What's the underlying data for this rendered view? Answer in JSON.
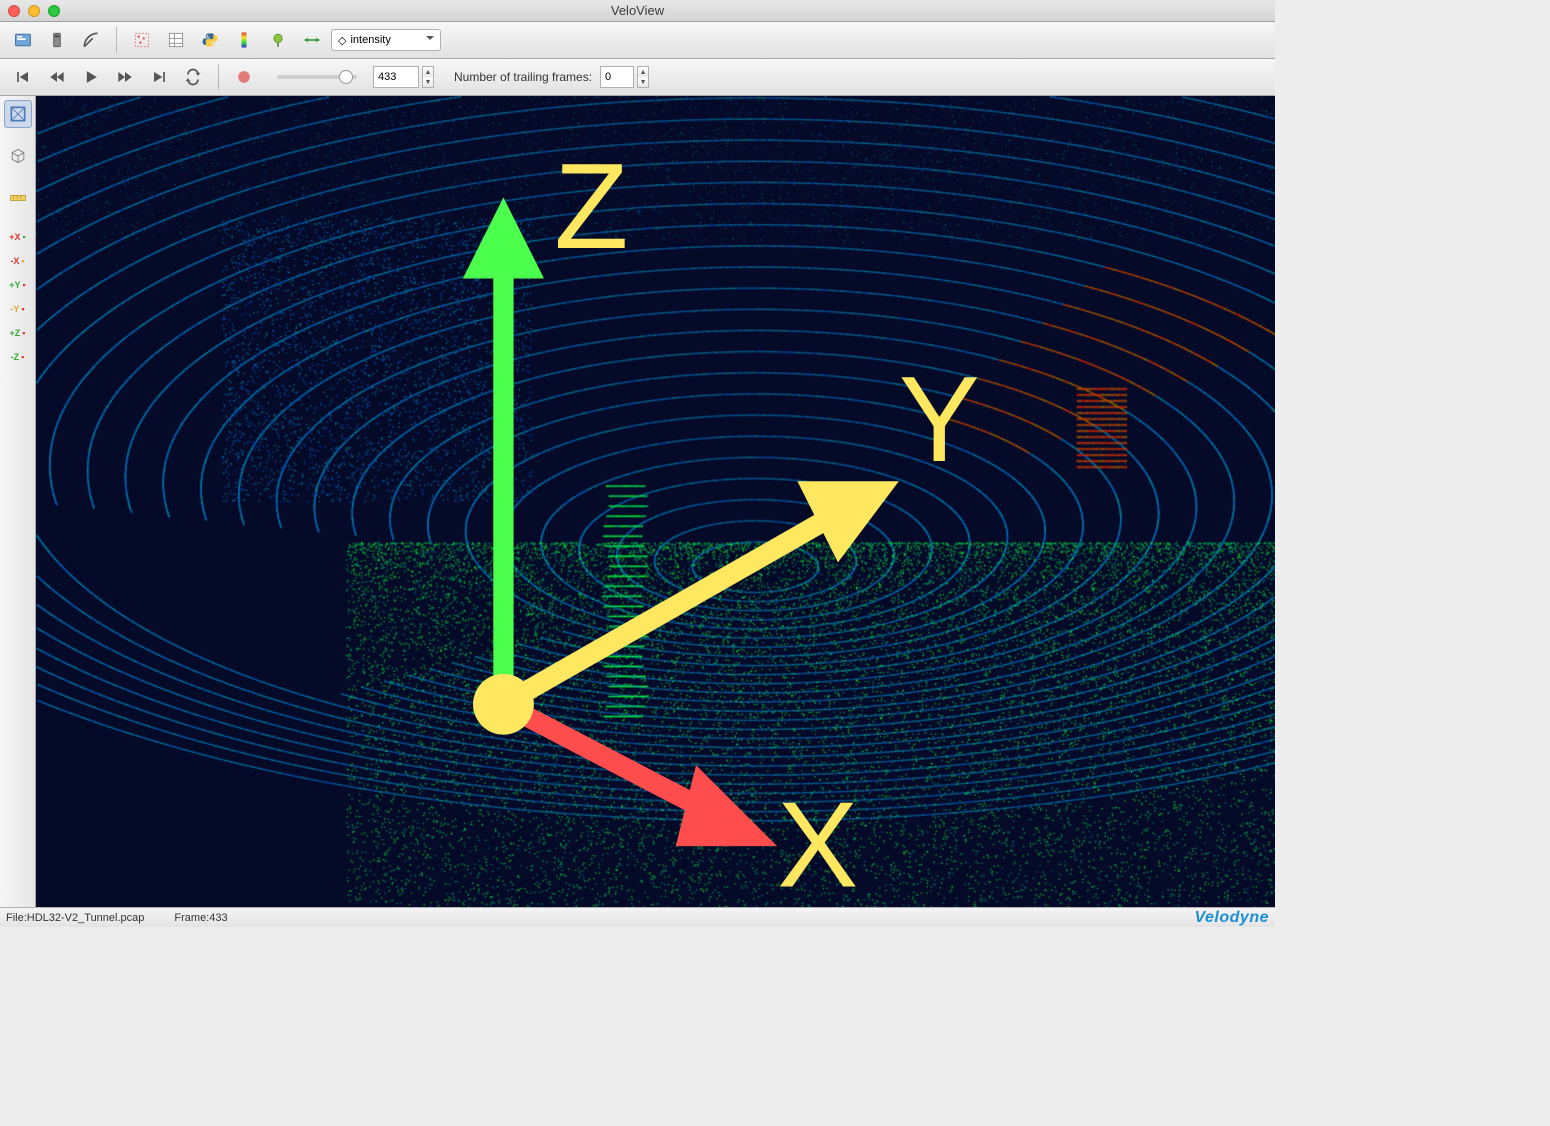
{
  "window": {
    "title": "VeloView"
  },
  "toolbar1": {
    "combo_label": "intensity",
    "icons": [
      "open-icon",
      "sensor-icon",
      "ruler-icon",
      "selection-icon",
      "spreadsheet-icon",
      "python-icon",
      "color-scale-icon",
      "crop-icon",
      "settings-icon"
    ]
  },
  "playback": {
    "frame": "433",
    "trailing_label": "Number of trailing frames:",
    "trailing_value": "0",
    "slider_pos": 0.78
  },
  "side": {
    "axis_buttons": [
      "+X",
      "-X",
      "+Y",
      "-Y",
      "+Z",
      "-Z"
    ]
  },
  "status": {
    "file_prefix": "File: ",
    "file": "HDL32-V2_Tunnel.pcap",
    "frame_prefix": "Frame: ",
    "frame": "433",
    "brand": "Velodyne"
  },
  "gizmo": {
    "x": "X",
    "y": "Y",
    "z": "Z"
  }
}
